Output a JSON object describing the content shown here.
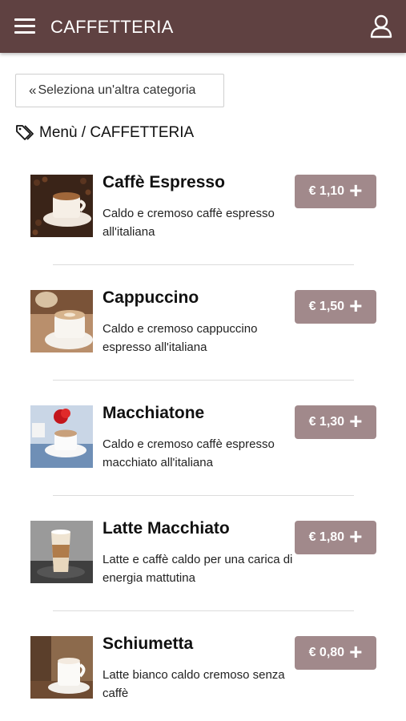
{
  "header": {
    "title": "CAFFETTERIA",
    "menu_icon": "hamburger-menu-icon",
    "user_icon": "user-icon",
    "background": "#5f4141"
  },
  "back_button": {
    "label": "Seleziona un'altra categoria",
    "icon": "double-chevron-left-icon"
  },
  "breadcrumb": {
    "text": "Menù / CAFFETTERIA",
    "icon": "tag-icon"
  },
  "accent_price_button": "#a1898b",
  "items": [
    {
      "name": "Caffè Espresso",
      "description": "Caldo e cremoso caffè espresso all'italiana",
      "price": "€ 1,10"
    },
    {
      "name": "Cappuccino",
      "description": "Caldo e cremoso cappuccino espresso all'italiana",
      "price": "€ 1,50"
    },
    {
      "name": "Macchiatone",
      "description": "Caldo e cremoso caffè espresso macchiato all'italiana",
      "price": "€ 1,30"
    },
    {
      "name": "Latte Macchiato",
      "description": "Latte e caffè caldo per una carica di energia mattutina",
      "price": "€ 1,80"
    },
    {
      "name": "Schiumetta",
      "description": "Latte bianco caldo cremoso senza caffè",
      "price": "€ 0,80"
    }
  ]
}
